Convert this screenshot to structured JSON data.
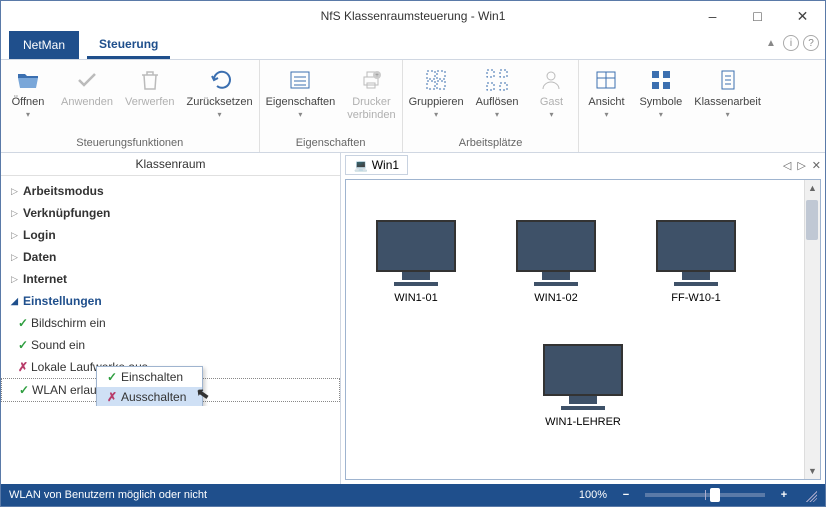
{
  "window": {
    "title": "NfS Klassenraumsteuerung - Win1"
  },
  "tabs": {
    "netman": "NetMan",
    "steuerung": "Steuerung"
  },
  "ribbon": {
    "groups": {
      "steuerungsfunktionen": "Steuerungsfunktionen",
      "eigenschaften": "Eigenschaften",
      "arbeitsplaetze": "Arbeitsplätze"
    },
    "buttons": {
      "oeffnen": "Öffnen",
      "anwenden": "Anwenden",
      "verwerfen": "Verwerfen",
      "zuruecksetzen": "Zurücksetzen",
      "eigenschaften": "Eigenschaften",
      "drucker": "Drucker\nverbinden",
      "gruppieren": "Gruppieren",
      "aufloesen": "Auflösen",
      "gast": "Gast",
      "ansicht": "Ansicht",
      "symbole": "Symbole",
      "klassenarbeit": "Klassenarbeit"
    }
  },
  "sidebar": {
    "title": "Klassenraum",
    "groups": {
      "arbeitsmodus": "Arbeitsmodus",
      "verknuepfungen": "Verknüpfungen",
      "login": "Login",
      "daten": "Daten",
      "internet": "Internet",
      "einstellungen": "Einstellungen"
    },
    "settings": {
      "bildschirm": "Bildschirm ein",
      "sound": "Sound ein",
      "laufwerke": "Lokale Laufwerke aus",
      "wlan": "WLAN erlaubt"
    }
  },
  "contextmenu": {
    "einschalten": "Einschalten",
    "ausschalten": "Ausschalten"
  },
  "main": {
    "tab": "Win1",
    "computers": [
      "WIN1-01",
      "WIN1-02",
      "FF-W10-1",
      "WIN1-LEHRER"
    ]
  },
  "statusbar": {
    "message": "WLAN von Benutzern möglich oder nicht",
    "zoom": "100%"
  }
}
